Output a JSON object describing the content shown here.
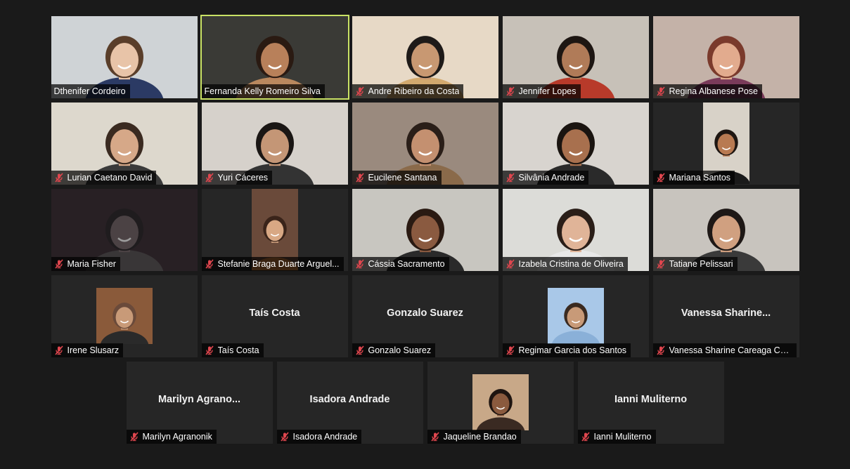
{
  "meeting": {
    "rows": [
      {
        "tiles": [
          {
            "name": "Dthenifer Cordeiro",
            "muted": false,
            "view": "video",
            "bg": "#cfd3d6",
            "shirt": "#2b3a64",
            "skin": "#e8c4a8",
            "hair": "#5a3e2a"
          },
          {
            "name": "Fernanda Kelly Romeiro Silva",
            "muted": false,
            "speaking": true,
            "view": "video",
            "bg": "#3a3a36",
            "shirt": "#b9885e",
            "skin": "#b8805a",
            "hair": "#2a1a12"
          },
          {
            "name": "Andre Ribeiro da Costa",
            "muted": true,
            "view": "video",
            "bg": "#e7d9c6",
            "shirt": "#d2a96e",
            "skin": "#c89872",
            "hair": "#1e1a18"
          },
          {
            "name": "Jennifer Lopes",
            "muted": true,
            "view": "video",
            "bg": "#c7c1b8",
            "shirt": "#b83a2a",
            "skin": "#b07b58",
            "hair": "#1d1612"
          },
          {
            "name": "Regina Albanese Pose",
            "muted": true,
            "view": "video",
            "bg": "#c4b2a8",
            "shirt": "#7a3a5a",
            "skin": "#e2ab8e",
            "hair": "#7a3a2c"
          }
        ]
      },
      {
        "tiles": [
          {
            "name": "Lurian Caetano David",
            "muted": true,
            "view": "video",
            "bg": "#ddd8cd",
            "shirt": "#3a3a3a",
            "skin": "#d6a888",
            "hair": "#3a2a20"
          },
          {
            "name": "Yuri Cáceres",
            "muted": true,
            "view": "video",
            "bg": "#d6d1cb",
            "shirt": "#333333",
            "skin": "#c49676",
            "hair": "#1a1614"
          },
          {
            "name": "Eucilene Santana",
            "muted": true,
            "view": "video",
            "bg": "#9a8a7e",
            "shirt": "#8a6a4a",
            "skin": "#c49070",
            "hair": "#2a1e18"
          },
          {
            "name": "Silvânia Andrade",
            "muted": true,
            "view": "video",
            "bg": "#d8d4cf",
            "shirt": "#2a2a2a",
            "skin": "#a8704e",
            "hair": "#1a1410"
          },
          {
            "name": "Mariana Santos",
            "muted": true,
            "view": "portrait",
            "bg": "#d8d2c8",
            "shirt": "#1a1a1a",
            "skin": "#b87a52",
            "hair": "#1e1612"
          }
        ]
      },
      {
        "tiles": [
          {
            "name": "Maria Fisher",
            "muted": true,
            "view": "dark",
            "bg": "#2a1c24",
            "shirt": "#4a4446",
            "skin": "#6a5a5e",
            "hair": "#1a1418"
          },
          {
            "name": "Stefanie Braga Duarte Arguel...",
            "muted": true,
            "view": "portrait",
            "bg": "#6a4a3a",
            "shirt": "#c87a3a",
            "skin": "#d8a884",
            "hair": "#3a241a"
          },
          {
            "name": "Cássia Sacramento",
            "muted": true,
            "view": "video",
            "bg": "#c8c6c0",
            "shirt": "#2a2a2a",
            "skin": "#8a5a40",
            "hair": "#2a1a12"
          },
          {
            "name": "Izabela Cristina de Oliveira",
            "muted": true,
            "view": "video",
            "bg": "#dcdcd8",
            "shirt": "#e8e8e8",
            "skin": "#e0b498",
            "hair": "#2a1e18"
          },
          {
            "name": "Tatiane Pelissari",
            "muted": true,
            "view": "video",
            "bg": "#c8c4be",
            "shirt": "#3a3a3a",
            "skin": "#d0a080",
            "hair": "#1e1816"
          }
        ]
      },
      {
        "tiles": [
          {
            "name": "Irene Slusarz",
            "muted": true,
            "view": "photo",
            "bg": "#8a5a3a",
            "shirt": "#2a2a2a",
            "skin": "#c89a78",
            "hair": "#6a4a3a"
          },
          {
            "name": "Taís Costa",
            "muted": true,
            "view": "name",
            "display": "Taís Costa"
          },
          {
            "name": "Gonzalo Suarez",
            "muted": true,
            "view": "name",
            "display": "Gonzalo Suarez"
          },
          {
            "name": "Regimar Garcia dos Santos",
            "muted": true,
            "view": "photo",
            "bg": "#a9c8e8",
            "shirt": "#8ab0d8",
            "skin": "#c89a78",
            "hair": "#3a2a20"
          },
          {
            "name": "Vanessa Sharine Careaga Ca...",
            "muted": true,
            "view": "name",
            "display": "Vanessa  Sharine..."
          }
        ]
      },
      {
        "tiles": [
          {
            "name": "Marilyn Agranonik",
            "muted": true,
            "view": "name",
            "display": "Marilyn  Agrano..."
          },
          {
            "name": "Isadora Andrade",
            "muted": true,
            "view": "name",
            "display": "Isadora Andrade"
          },
          {
            "name": "Jaqueline Brandao",
            "muted": true,
            "view": "photo",
            "bg": "#c8a888",
            "shirt": "#3a2a22",
            "skin": "#8a5a3e",
            "hair": "#1e1410"
          },
          {
            "name": "Ianni Muliterno",
            "muted": true,
            "view": "name",
            "display": "Ianni Muliterno"
          }
        ]
      }
    ]
  },
  "colors": {
    "background": "#1a1a1a",
    "tile": "#262626",
    "active_speaker": "#c9e265",
    "mute_icon": "#e0464e"
  }
}
